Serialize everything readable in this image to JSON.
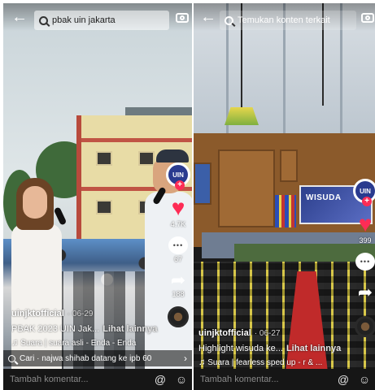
{
  "left": {
    "search": {
      "query": "pbak uin jakarta"
    },
    "rail": {
      "avatar_text": "UIN",
      "likes": "4.7K",
      "comments": "67",
      "shares": "188"
    },
    "caption": {
      "username": "uinjktofficial",
      "date": "· 06-29",
      "description": "PBAK 2023 UIN Jak...",
      "more": "Lihat lainnya",
      "music": "Suara | suara asli - Enda - Enda"
    },
    "related": "Cari · najwa shihab datang ke ipb 60",
    "comment_placeholder": "Tambah komentar...",
    "icons": {
      "back": "back-arrow-icon",
      "camera": "camera-icon",
      "mention": "at-icon",
      "emoji": "emoji-icon"
    }
  },
  "right": {
    "search": {
      "placeholder": "Temukan konten terkait"
    },
    "banner": "WISUDA",
    "rail": {
      "avatar_text": "UIN",
      "likes": "399"
    },
    "caption": {
      "username": "uinjktofficial",
      "date": "· 06-27",
      "description": "Highlight wisuda ke...",
      "more": "Lihat lainnya",
      "music": "Suara | fearless sped up - r & ..."
    },
    "comment_placeholder": "Tambah komentar...",
    "icons": {
      "back": "back-arrow-icon",
      "camera": "camera-icon",
      "mention": "at-icon",
      "emoji": "emoji-icon"
    }
  },
  "colors": {
    "like_red": "#fe2c55",
    "comment_bar": "#161616"
  }
}
